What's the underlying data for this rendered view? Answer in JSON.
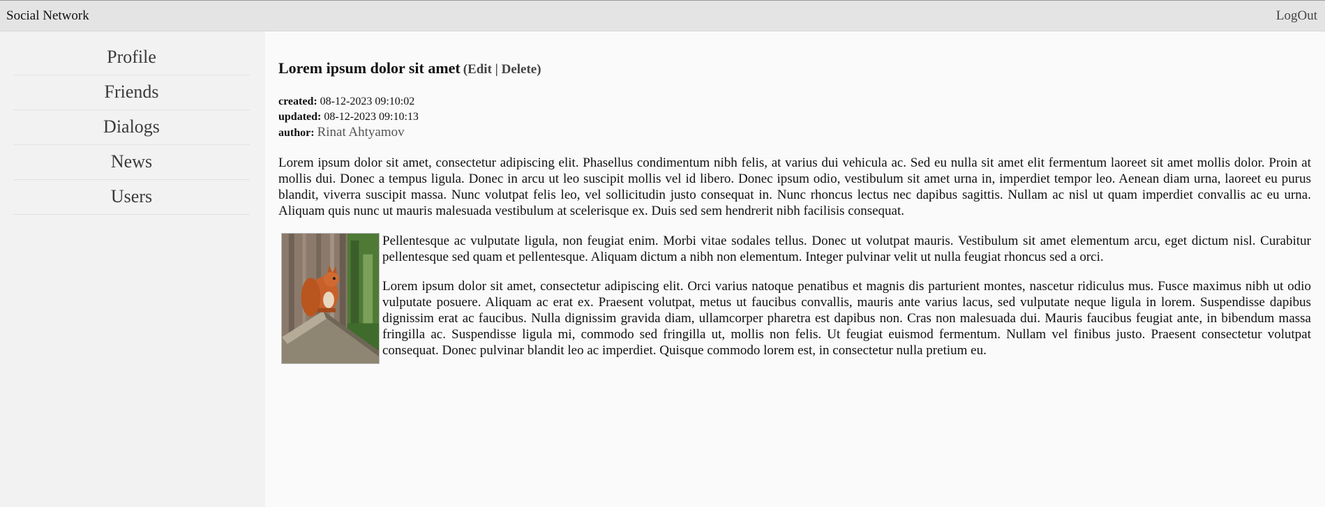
{
  "header": {
    "brand": "Social Network",
    "logout": "LogOut"
  },
  "sidebar": {
    "items": [
      {
        "label": "Profile"
      },
      {
        "label": "Friends"
      },
      {
        "label": "Dialogs"
      },
      {
        "label": "News"
      },
      {
        "label": "Users"
      }
    ]
  },
  "post": {
    "title": "Lorem ipsum dolor sit amet",
    "paren_open": "(",
    "edit": "Edit",
    "separator": " | ",
    "delete": "Delete",
    "paren_close": ")",
    "created_label": "created:",
    "created_value": "08-12-2023 09:10:02",
    "updated_label": "updated:",
    "updated_value": "08-12-2023 09:10:13",
    "author_label": "author:",
    "author_name": "Rinat Ahtyamov",
    "paragraph1": "Lorem ipsum dolor sit amet, consectetur adipiscing elit. Phasellus condimentum nibh felis, at varius dui vehicula ac. Sed eu nulla sit amet elit fermentum laoreet sit amet mollis dolor. Proin at mollis dui. Donec a tempus ligula. Donec in arcu ut leo suscipit mollis vel id libero. Donec ipsum odio, vestibulum sit amet urna in, imperdiet tempor leo. Aenean diam urna, laoreet eu purus blandit, viverra suscipit massa. Nunc volutpat felis leo, vel sollicitudin justo consequat in. Nunc rhoncus lectus nec dapibus sagittis. Nullam ac nisl ut quam imperdiet convallis ac eu urna. Aliquam quis nunc ut mauris malesuada vestibulum at scelerisque ex. Duis sed sem hendrerit nibh facilisis consequat.",
    "paragraph2": "Pellentesque ac vulputate ligula, non feugiat enim. Morbi vitae sodales tellus. Donec ut volutpat mauris. Vestibulum sit amet elementum arcu, eget dictum nisl. Curabitur pellentesque sed quam et pellentesque. Aliquam dictum a nibh non elementum. Integer pulvinar velit ut nulla feugiat rhoncus sed a orci.",
    "paragraph3": "Lorem ipsum dolor sit amet, consectetur adipiscing elit. Orci varius natoque penatibus et magnis dis parturient montes, nascetur ridiculus mus. Fusce maximus nibh ut odio vulputate posuere. Aliquam ac erat ex. Praesent volutpat, metus ut faucibus convallis, mauris ante varius lacus, sed vulputate neque ligula in lorem. Suspendisse dapibus dignissim erat ac faucibus. Nulla dignissim gravida diam, ullamcorper pharetra est dapibus non. Cras non malesuada dui. Mauris faucibus feugiat ante, in bibendum massa fringilla ac. Suspendisse ligula mi, commodo sed fringilla ut, mollis non felis. Ut feugiat euismod fermentum. Nullam vel finibus justo. Praesent consectetur volutpat consequat. Donec pulvinar blandit leo ac imperdiet. Quisque commodo lorem est, in consectetur nulla pretium eu."
  }
}
